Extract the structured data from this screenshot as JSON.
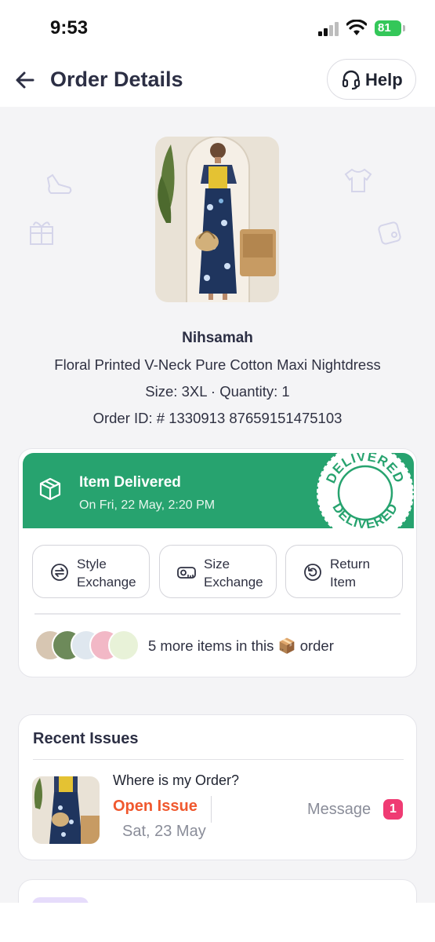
{
  "status_bar": {
    "time": "9:53",
    "battery": "81"
  },
  "header": {
    "title": "Order Details",
    "help_label": "Help"
  },
  "product": {
    "brand": "Nihsamah",
    "name": "Floral Printed V-Neck Pure Cotton Maxi Nightdress",
    "size_qty": "Size: 3XL · Quantity: 1",
    "order_id": "Order ID: # 1330913 87659151475103"
  },
  "delivery": {
    "title": "Item Delivered",
    "date": "On Fri, 22 May, 2:20 PM",
    "stamp_text": "DELIVERED",
    "color": "#27a36f"
  },
  "actions": [
    {
      "line1": "Style",
      "line2": "Exchange",
      "icon": "exchange-arrows-icon"
    },
    {
      "line1": "Size",
      "line2": "Exchange",
      "icon": "measuring-tape-icon"
    },
    {
      "line1": "Return",
      "line2": "Item",
      "icon": "return-icon"
    }
  ],
  "more_items": {
    "text": "5 more items in this 📦 order"
  },
  "recent_issues": {
    "title": "Recent Issues",
    "issue": {
      "question": "Where is my Order?",
      "status": "Open Issue",
      "date": "Sat, 23 May",
      "message_label": "Message",
      "message_count": "1"
    }
  },
  "colors": {
    "accent_green": "#27a36f",
    "issue_orange": "#f0582e",
    "badge_pink": "#ef3b73"
  }
}
